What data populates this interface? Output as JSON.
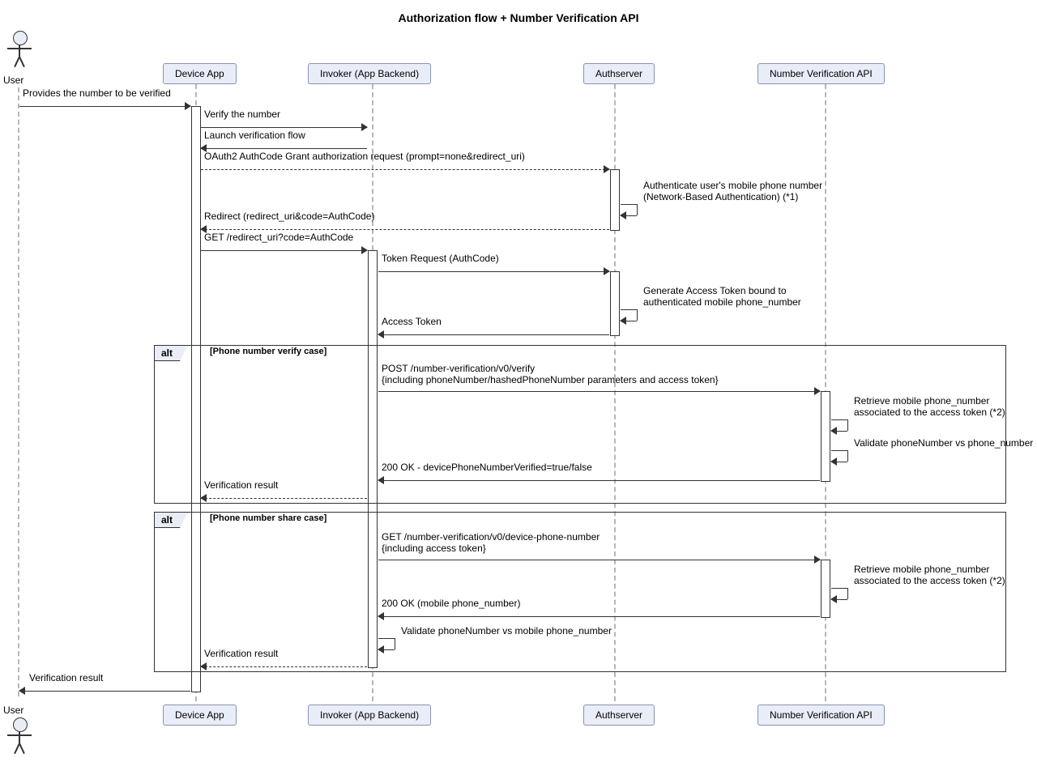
{
  "title": "Authorization flow + Number Verification API",
  "participants": {
    "user": "User",
    "device": "Device App",
    "invoker": "Invoker (App Backend)",
    "auth": "Authserver",
    "nvapi": "Number Verification API"
  },
  "messages": {
    "m1": "Provides the number to be verified",
    "m2": "Verify the number",
    "m3": "Launch verification flow",
    "m4": "OAuth2 AuthCode Grant authorization request  (prompt=none&redirect_uri)",
    "m5a": "Authenticate user's mobile phone number",
    "m5b": "(Network-Based Authentication) (*1)",
    "m6": "Redirect (redirect_uri&code=AuthCode)",
    "m7": "GET /redirect_uri?code=AuthCode",
    "m8": "Token Request (AuthCode)",
    "m9a": "Generate Access Token bound to",
    "m9b": "authenticated mobile phone_number",
    "m10": "Access Token",
    "alt1_tag": "alt",
    "alt1_cond": "[Phone number verify case]",
    "m11a": "POST /number-verification/v0/verify",
    "m11b": "{including phoneNumber/hashedPhoneNumber parameters and access token}",
    "m12a": "Retrieve mobile phone_number",
    "m12b": "associated to the access token (*2)",
    "m13": "Validate phoneNumber vs phone_number",
    "m14": "200 OK - devicePhoneNumberVerified=true/false",
    "m15": "Verification result",
    "alt2_tag": "alt",
    "alt2_cond": "[Phone number share case]",
    "m16a": "GET /number-verification/v0/device-phone-number",
    "m16b": "{including access token}",
    "m17a": "Retrieve mobile phone_number",
    "m17b": "associated to the access token (*2)",
    "m18": "200 OK (mobile phone_number)",
    "m19": "Validate phoneNumber vs mobile phone_number",
    "m20": "Verification result",
    "m21": "Verification result"
  },
  "chart_data": {
    "type": "sequence-diagram",
    "title": "Authorization flow + Number Verification API",
    "participants": [
      "User",
      "Device App",
      "Invoker (App Backend)",
      "Authserver",
      "Number Verification API"
    ],
    "messages": [
      {
        "from": "User",
        "to": "Device App",
        "text": "Provides the number to be verified",
        "style": "solid"
      },
      {
        "from": "Device App",
        "to": "Invoker (App Backend)",
        "text": "Verify the number",
        "style": "solid"
      },
      {
        "from": "Invoker (App Backend)",
        "to": "Device App",
        "text": "Launch verification flow",
        "style": "solid"
      },
      {
        "from": "Device App",
        "to": "Authserver",
        "text": "OAuth2 AuthCode Grant authorization request  (prompt=none&redirect_uri)",
        "style": "dashed"
      },
      {
        "from": "Authserver",
        "to": "Authserver",
        "text": "Authenticate user's mobile phone number (Network-Based Authentication) (*1)",
        "style": "self"
      },
      {
        "from": "Authserver",
        "to": "Device App",
        "text": "Redirect (redirect_uri&code=AuthCode)",
        "style": "dashed"
      },
      {
        "from": "Device App",
        "to": "Invoker (App Backend)",
        "text": "GET /redirect_uri?code=AuthCode",
        "style": "solid"
      },
      {
        "from": "Invoker (App Backend)",
        "to": "Authserver",
        "text": "Token Request (AuthCode)",
        "style": "solid"
      },
      {
        "from": "Authserver",
        "to": "Authserver",
        "text": "Generate Access Token bound to authenticated mobile phone_number",
        "style": "self"
      },
      {
        "from": "Authserver",
        "to": "Invoker (App Backend)",
        "text": "Access Token",
        "style": "solid"
      }
    ],
    "fragments": [
      {
        "type": "alt",
        "condition": "[Phone number verify case]",
        "messages": [
          {
            "from": "Invoker (App Backend)",
            "to": "Number Verification API",
            "text": "POST /number-verification/v0/verify {including phoneNumber/hashedPhoneNumber parameters and access token}",
            "style": "solid"
          },
          {
            "from": "Number Verification API",
            "to": "Number Verification API",
            "text": "Retrieve mobile phone_number associated to the access token (*2)",
            "style": "self"
          },
          {
            "from": "Number Verification API",
            "to": "Number Verification API",
            "text": "Validate phoneNumber vs phone_number",
            "style": "self"
          },
          {
            "from": "Number Verification API",
            "to": "Invoker (App Backend)",
            "text": "200 OK - devicePhoneNumberVerified=true/false",
            "style": "solid"
          },
          {
            "from": "Invoker (App Backend)",
            "to": "Device App",
            "text": "Verification result",
            "style": "dashed"
          }
        ]
      },
      {
        "type": "alt",
        "condition": "[Phone number share case]",
        "messages": [
          {
            "from": "Invoker (App Backend)",
            "to": "Number Verification API",
            "text": "GET /number-verification/v0/device-phone-number {including access token}",
            "style": "solid"
          },
          {
            "from": "Number Verification API",
            "to": "Number Verification API",
            "text": "Retrieve mobile phone_number associated to the access token (*2)",
            "style": "self"
          },
          {
            "from": "Number Verification API",
            "to": "Invoker (App Backend)",
            "text": "200 OK (mobile phone_number)",
            "style": "solid"
          },
          {
            "from": "Invoker (App Backend)",
            "to": "Invoker (App Backend)",
            "text": "Validate phoneNumber vs mobile phone_number",
            "style": "self"
          },
          {
            "from": "Invoker (App Backend)",
            "to": "Device App",
            "text": "Verification result",
            "style": "dashed"
          }
        ]
      }
    ],
    "final_messages": [
      {
        "from": "Device App",
        "to": "User",
        "text": "Verification result",
        "style": "solid"
      }
    ]
  }
}
